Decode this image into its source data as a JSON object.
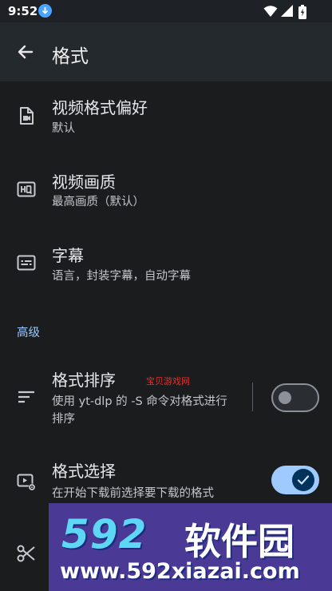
{
  "status_bar": {
    "time": "9:52",
    "icons": [
      "download-icon",
      "wifi-icon",
      "signal-icon",
      "battery-icon"
    ]
  },
  "app_bar": {
    "title": "格式",
    "back_icon": "arrow-back-icon"
  },
  "items": [
    {
      "icon": "video-file-icon",
      "title": "视频格式偏好",
      "subtitle": "默认"
    },
    {
      "icon": "hq-icon",
      "title": "视频画质",
      "subtitle": "最高画质（默认）"
    },
    {
      "icon": "subtitles-icon",
      "title": "字幕",
      "subtitle": "语言，封装字幕，自动字幕"
    }
  ],
  "section_advanced": "高级",
  "advanced_items": [
    {
      "icon": "sort-icon",
      "title": "格式排序",
      "subtitle_line1": "使用 yt-dlp 的 -S 命令对格式进行",
      "subtitle_line2": "排序",
      "switch_on": false
    },
    {
      "icon": "video-settings-icon",
      "title": "格式选择",
      "subtitle": "在开始下载前选择要下载的格式",
      "switch_on": true
    },
    {
      "icon": "scissors-icon"
    }
  ],
  "watermark": {
    "small_text": "宝贝游戏网",
    "logo_number": "592",
    "logo_cn": "软件园",
    "url": "www.592xiazai.com"
  },
  "colors": {
    "background": "#1a1c1e",
    "app_bar": "#24292e",
    "accent": "#9ecaff",
    "watermark_bg": "#4a3a95"
  }
}
